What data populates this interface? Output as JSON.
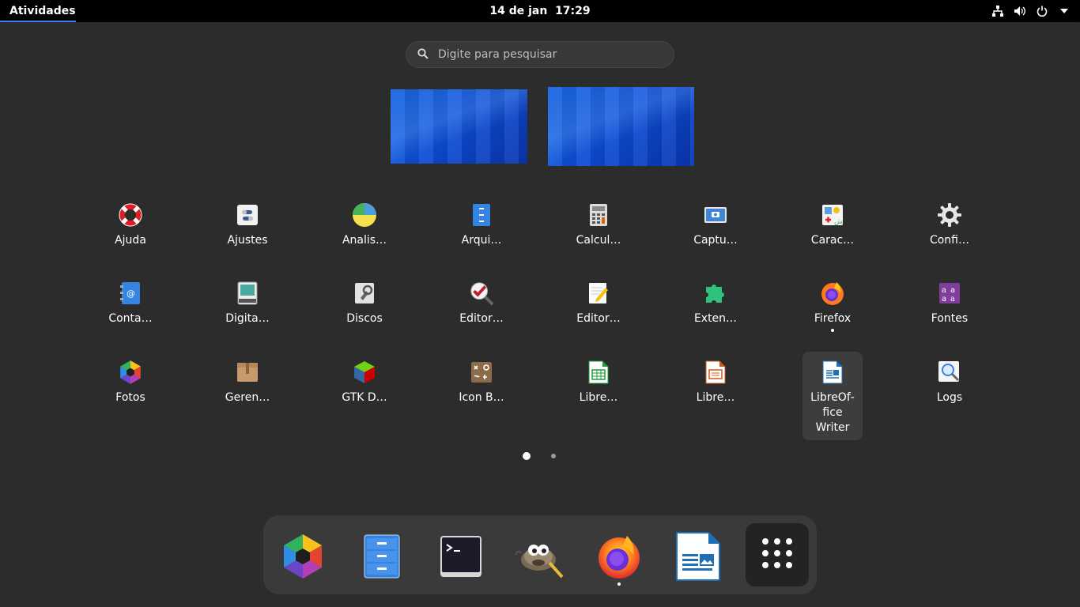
{
  "topbar": {
    "activities_label": "Atividades",
    "clock_date": "14 de jan",
    "clock_time": "17:29",
    "tray_icons": [
      "network-icon",
      "volume-icon",
      "power-icon",
      "chevron-down-icon"
    ]
  },
  "search": {
    "placeholder": "Digite para pesquisar"
  },
  "workspaces": [
    {
      "name": "workspace-1"
    },
    {
      "name": "workspace-2"
    }
  ],
  "apps": [
    {
      "label": "Ajuda",
      "icon": "help-lifebuoy-icon"
    },
    {
      "label": "Ajustes",
      "icon": "tweaks-icon"
    },
    {
      "label": "Analis…",
      "icon": "disk-usage-analyzer-icon"
    },
    {
      "label": "Arqui…",
      "icon": "files-cabinet-icon"
    },
    {
      "label": "Calcul…",
      "icon": "calculator-icon"
    },
    {
      "label": "Captu…",
      "icon": "screenshot-camera-icon"
    },
    {
      "label": "Carac…",
      "icon": "characters-icon"
    },
    {
      "label": "Confi…",
      "icon": "settings-gear-icon"
    },
    {
      "label": "Conta…",
      "icon": "contacts-icon"
    },
    {
      "label": "Digita…",
      "icon": "scanner-icon"
    },
    {
      "label": "Discos",
      "icon": "disks-icon"
    },
    {
      "label": "Editor…",
      "icon": "dconf-editor-icon"
    },
    {
      "label": "Editor…",
      "icon": "text-editor-icon"
    },
    {
      "label": "Exten…",
      "icon": "extensions-puzzle-icon"
    },
    {
      "label": "Firefox",
      "icon": "firefox-icon",
      "running": true
    },
    {
      "label": "Fontes",
      "icon": "fonts-icon"
    },
    {
      "label": "Fotos",
      "icon": "photos-icon"
    },
    {
      "label": "Geren…",
      "icon": "archive-manager-icon"
    },
    {
      "label": "GTK D…",
      "icon": "gtk-demo-cube-icon"
    },
    {
      "label": "Icon B…",
      "icon": "icon-browser-icon"
    },
    {
      "label": "Libre…",
      "icon": "libreoffice-calc-icon"
    },
    {
      "label": "Libre…",
      "icon": "libreoffice-impress-icon"
    },
    {
      "label": "LibreOf­fice Writer",
      "icon": "libreoffice-writer-icon",
      "selected": true
    },
    {
      "label": "Logs",
      "icon": "logs-search-icon"
    }
  ],
  "pager": {
    "pages": 2,
    "current": 1
  },
  "dock": [
    {
      "name": "photos-icon"
    },
    {
      "name": "files-cabinet-icon"
    },
    {
      "name": "terminal-icon"
    },
    {
      "name": "gimp-icon"
    },
    {
      "name": "firefox-icon",
      "running": true
    },
    {
      "name": "libreoffice-writer-icon"
    },
    {
      "name": "show-apps-grid-icon"
    }
  ],
  "colors": {
    "accent": "#3584e4",
    "panel": "#000000",
    "overview_bg": "#2c2c2c",
    "dock_bg": "#3a3a3a"
  }
}
